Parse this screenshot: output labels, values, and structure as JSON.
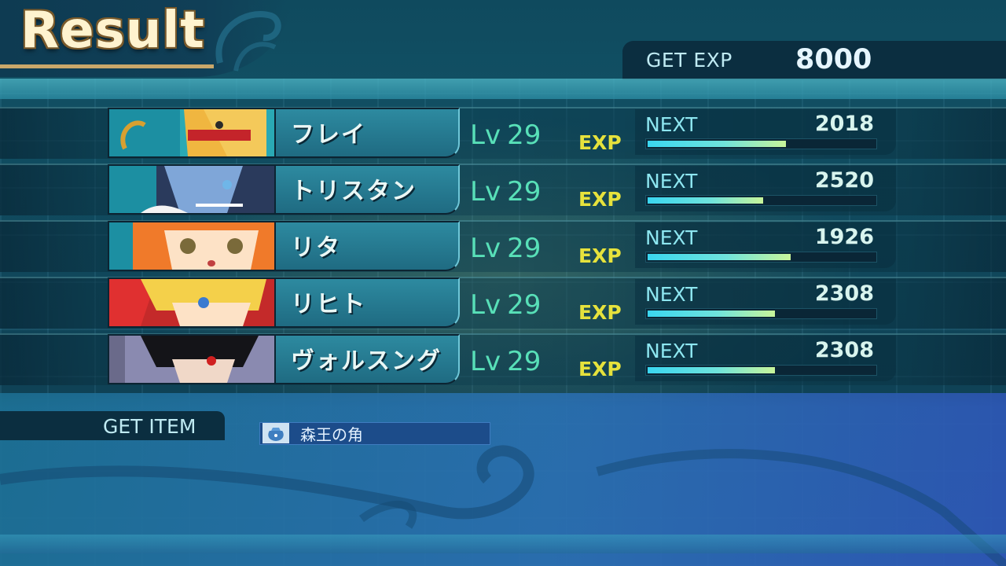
{
  "header": {
    "title": "Result",
    "get_exp_label": "GET EXP",
    "get_exp_value": "8000"
  },
  "party": [
    {
      "name": "フレイ",
      "lv_label": "Lv",
      "level": "29",
      "exp_tag": "EXP",
      "next_label": "NEXT",
      "next_value": "2018",
      "exp_progress": 0.61
    },
    {
      "name": "トリスタン",
      "lv_label": "Lv",
      "level": "29",
      "exp_tag": "EXP",
      "next_label": "NEXT",
      "next_value": "2520",
      "exp_progress": 0.51
    },
    {
      "name": "リタ",
      "lv_label": "Lv",
      "level": "29",
      "exp_tag": "EXP",
      "next_label": "NEXT",
      "next_value": "1926",
      "exp_progress": 0.63
    },
    {
      "name": "リヒト",
      "lv_label": "Lv",
      "level": "29",
      "exp_tag": "EXP",
      "next_label": "NEXT",
      "next_value": "2308",
      "exp_progress": 0.56
    },
    {
      "name": "ヴォルスング",
      "lv_label": "Lv",
      "level": "29",
      "exp_tag": "EXP",
      "next_label": "NEXT",
      "next_value": "2308",
      "exp_progress": 0.56
    }
  ],
  "items": {
    "label": "GET ITEM",
    "list": [
      {
        "name": "森王の角",
        "icon": "item-bag-icon"
      }
    ]
  },
  "colors": {
    "level_text": "#58e0b8",
    "exp_tag": "#e6e23c",
    "bar_start": "#3ad6f0",
    "bar_end": "#c8f59a"
  }
}
